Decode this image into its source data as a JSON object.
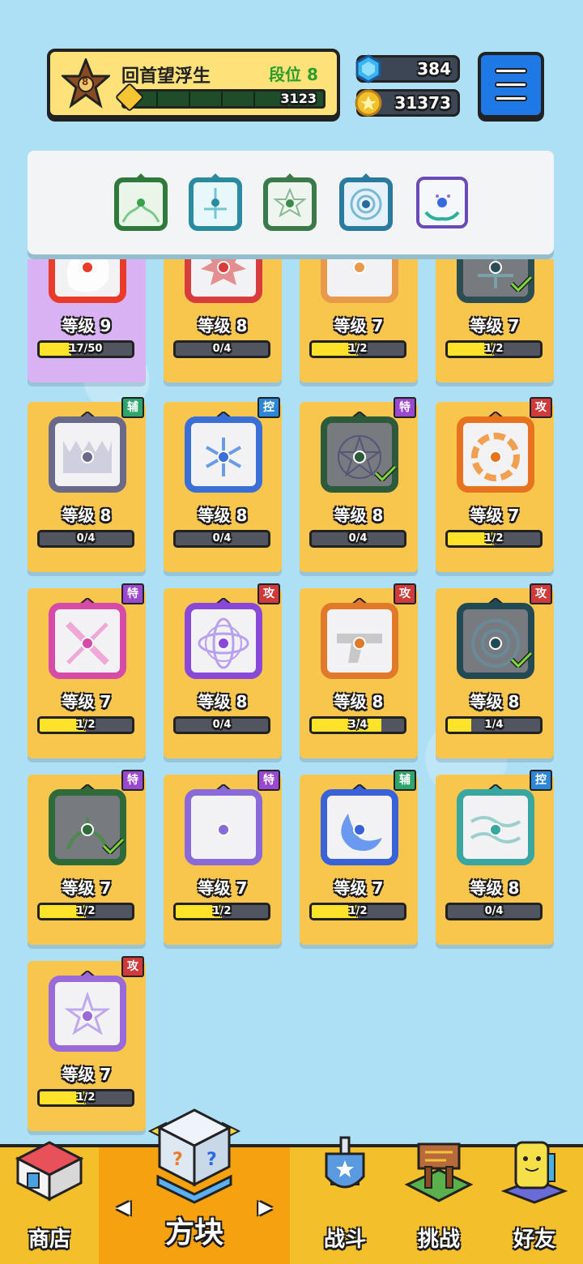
{
  "header": {
    "player_name": "回首望浮生",
    "rank_label": "段位 8",
    "rank_badge_number": "8",
    "xp_value": "3123",
    "gems": "384",
    "coins": "31373"
  },
  "deck": {
    "slots": [
      "green-wind-tile",
      "cyan-cross-tile",
      "green-pentagram-tile",
      "blue-vortex-tile",
      "teal-healing-hands-tile"
    ]
  },
  "cards": [
    {
      "level": "等级 9",
      "progress": "17/50",
      "fill": 0.34,
      "tag": "",
      "tag_color": "",
      "selected": true,
      "check": false,
      "color": "#e83b2a",
      "emblem": "fire"
    },
    {
      "level": "等级 8",
      "progress": "0/4",
      "fill": 0,
      "tag": "",
      "tag_color": "",
      "selected": false,
      "check": false,
      "color": "#d83c3c",
      "emblem": "sun"
    },
    {
      "level": "等级 7",
      "progress": "1/2",
      "fill": 0.5,
      "tag": "",
      "tag_color": "",
      "selected": false,
      "check": false,
      "color": "#e89a4a",
      "emblem": "dot"
    },
    {
      "level": "等级 7",
      "progress": "1/2",
      "fill": 0.5,
      "tag": "",
      "tag_color": "",
      "selected": false,
      "check": true,
      "color": "#2d4d55",
      "emblem": "cross"
    },
    {
      "level": "等级 8",
      "progress": "0/4",
      "fill": 0,
      "tag": "辅",
      "tag_color": "#2ea56b",
      "selected": false,
      "check": false,
      "color": "#6a6a88",
      "emblem": "teeth"
    },
    {
      "level": "等级 8",
      "progress": "0/4",
      "fill": 0,
      "tag": "控",
      "tag_color": "#2e86d6",
      "selected": false,
      "check": false,
      "color": "#3a6fd8",
      "emblem": "snow"
    },
    {
      "level": "等级 8",
      "progress": "0/4",
      "fill": 0,
      "tag": "特",
      "tag_color": "#9a48d0",
      "selected": false,
      "check": true,
      "color": "#2d5a3a",
      "emblem": "pentagram"
    },
    {
      "level": "等级 7",
      "progress": "1/2",
      "fill": 0.5,
      "tag": "攻",
      "tag_color": "#d03a3a",
      "selected": false,
      "check": false,
      "color": "#e8731f",
      "emblem": "flame-ring"
    },
    {
      "level": "等级 7",
      "progress": "1/2",
      "fill": 0.5,
      "tag": "特",
      "tag_color": "#9a48d0",
      "selected": false,
      "check": false,
      "color": "#d64aa8",
      "emblem": "syringe"
    },
    {
      "level": "等级 8",
      "progress": "0/4",
      "fill": 0,
      "tag": "攻",
      "tag_color": "#d03a3a",
      "selected": false,
      "check": false,
      "color": "#8a48d8",
      "emblem": "atom"
    },
    {
      "level": "等级 8",
      "progress": "3/4",
      "fill": 0.75,
      "tag": "攻",
      "tag_color": "#d03a3a",
      "selected": false,
      "check": false,
      "color": "#e07a2a",
      "emblem": "gun"
    },
    {
      "level": "等级 8",
      "progress": "1/4",
      "fill": 0.25,
      "tag": "攻",
      "tag_color": "#d03a3a",
      "selected": false,
      "check": true,
      "color": "#224a55",
      "emblem": "vortex"
    },
    {
      "level": "等级 7",
      "progress": "1/2",
      "fill": 0.5,
      "tag": "特",
      "tag_color": "#9a48d0",
      "selected": false,
      "check": true,
      "color": "#2f6a3a",
      "emblem": "wind"
    },
    {
      "level": "等级 7",
      "progress": "1/2",
      "fill": 0.5,
      "tag": "特",
      "tag_color": "#9a48d0",
      "selected": false,
      "check": false,
      "color": "#8a6ad8",
      "emblem": "dot"
    },
    {
      "level": "等级 7",
      "progress": "1/2",
      "fill": 0.5,
      "tag": "辅",
      "tag_color": "#2ea56b",
      "selected": false,
      "check": false,
      "color": "#3a62d8",
      "emblem": "moon"
    },
    {
      "level": "等级 8",
      "progress": "0/4",
      "fill": 0,
      "tag": "控",
      "tag_color": "#2e86d6",
      "selected": false,
      "check": false,
      "color": "#3aa6a0",
      "emblem": "wave"
    },
    {
      "level": "等级 7",
      "progress": "1/2",
      "fill": 0.5,
      "tag": "攻",
      "tag_color": "#d03a3a",
      "selected": false,
      "check": false,
      "color": "#9a6ad8",
      "emblem": "star"
    }
  ],
  "nav": {
    "shop": "商店",
    "blocks": "方块",
    "battle": "战斗",
    "challenge": "挑战",
    "friends": "好友",
    "prev_arrow": "◀",
    "next_arrow": "▶"
  }
}
